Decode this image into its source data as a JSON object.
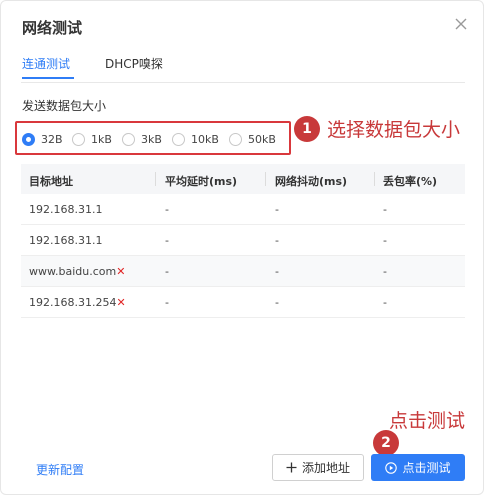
{
  "dialog": {
    "title": "网络测试"
  },
  "tabs": [
    {
      "label": "连通测试",
      "active": true
    },
    {
      "label": "DHCP嗅探",
      "active": false
    }
  ],
  "packet_size": {
    "label": "发送数据包大小",
    "options": [
      "32B",
      "1kB",
      "3kB",
      "10kB",
      "50kB"
    ],
    "selected": "32B"
  },
  "table": {
    "headers": [
      "目标地址",
      "平均延时(ms)",
      "网络抖动(ms)",
      "丢包率(%)"
    ],
    "rows": [
      {
        "address": "192.168.31.1",
        "avg_delay": "-",
        "jitter": "-",
        "loss": "-",
        "error": false
      },
      {
        "address": "192.168.31.1",
        "avg_delay": "-",
        "jitter": "-",
        "loss": "-",
        "error": false
      },
      {
        "address": "www.baidu.com",
        "avg_delay": "-",
        "jitter": "-",
        "loss": "-",
        "error": true
      },
      {
        "address": "192.168.31.254",
        "avg_delay": "-",
        "jitter": "-",
        "loss": "-",
        "error": true
      }
    ],
    "error_mark": "✕"
  },
  "footer": {
    "refresh_label": "更新配置",
    "add_label": "添加地址",
    "test_label": "点击测试"
  },
  "annotations": {
    "step1_number": "1",
    "step1_text": "选择数据包大小",
    "step2_number": "2",
    "step2_text": "点击测试"
  },
  "colors": {
    "accent": "#2f7df6",
    "annotation": "#c8393a",
    "error": "#e02424"
  },
  "icons": {
    "close": "close-icon",
    "add": "plus-icon",
    "test": "play-circle-icon"
  }
}
